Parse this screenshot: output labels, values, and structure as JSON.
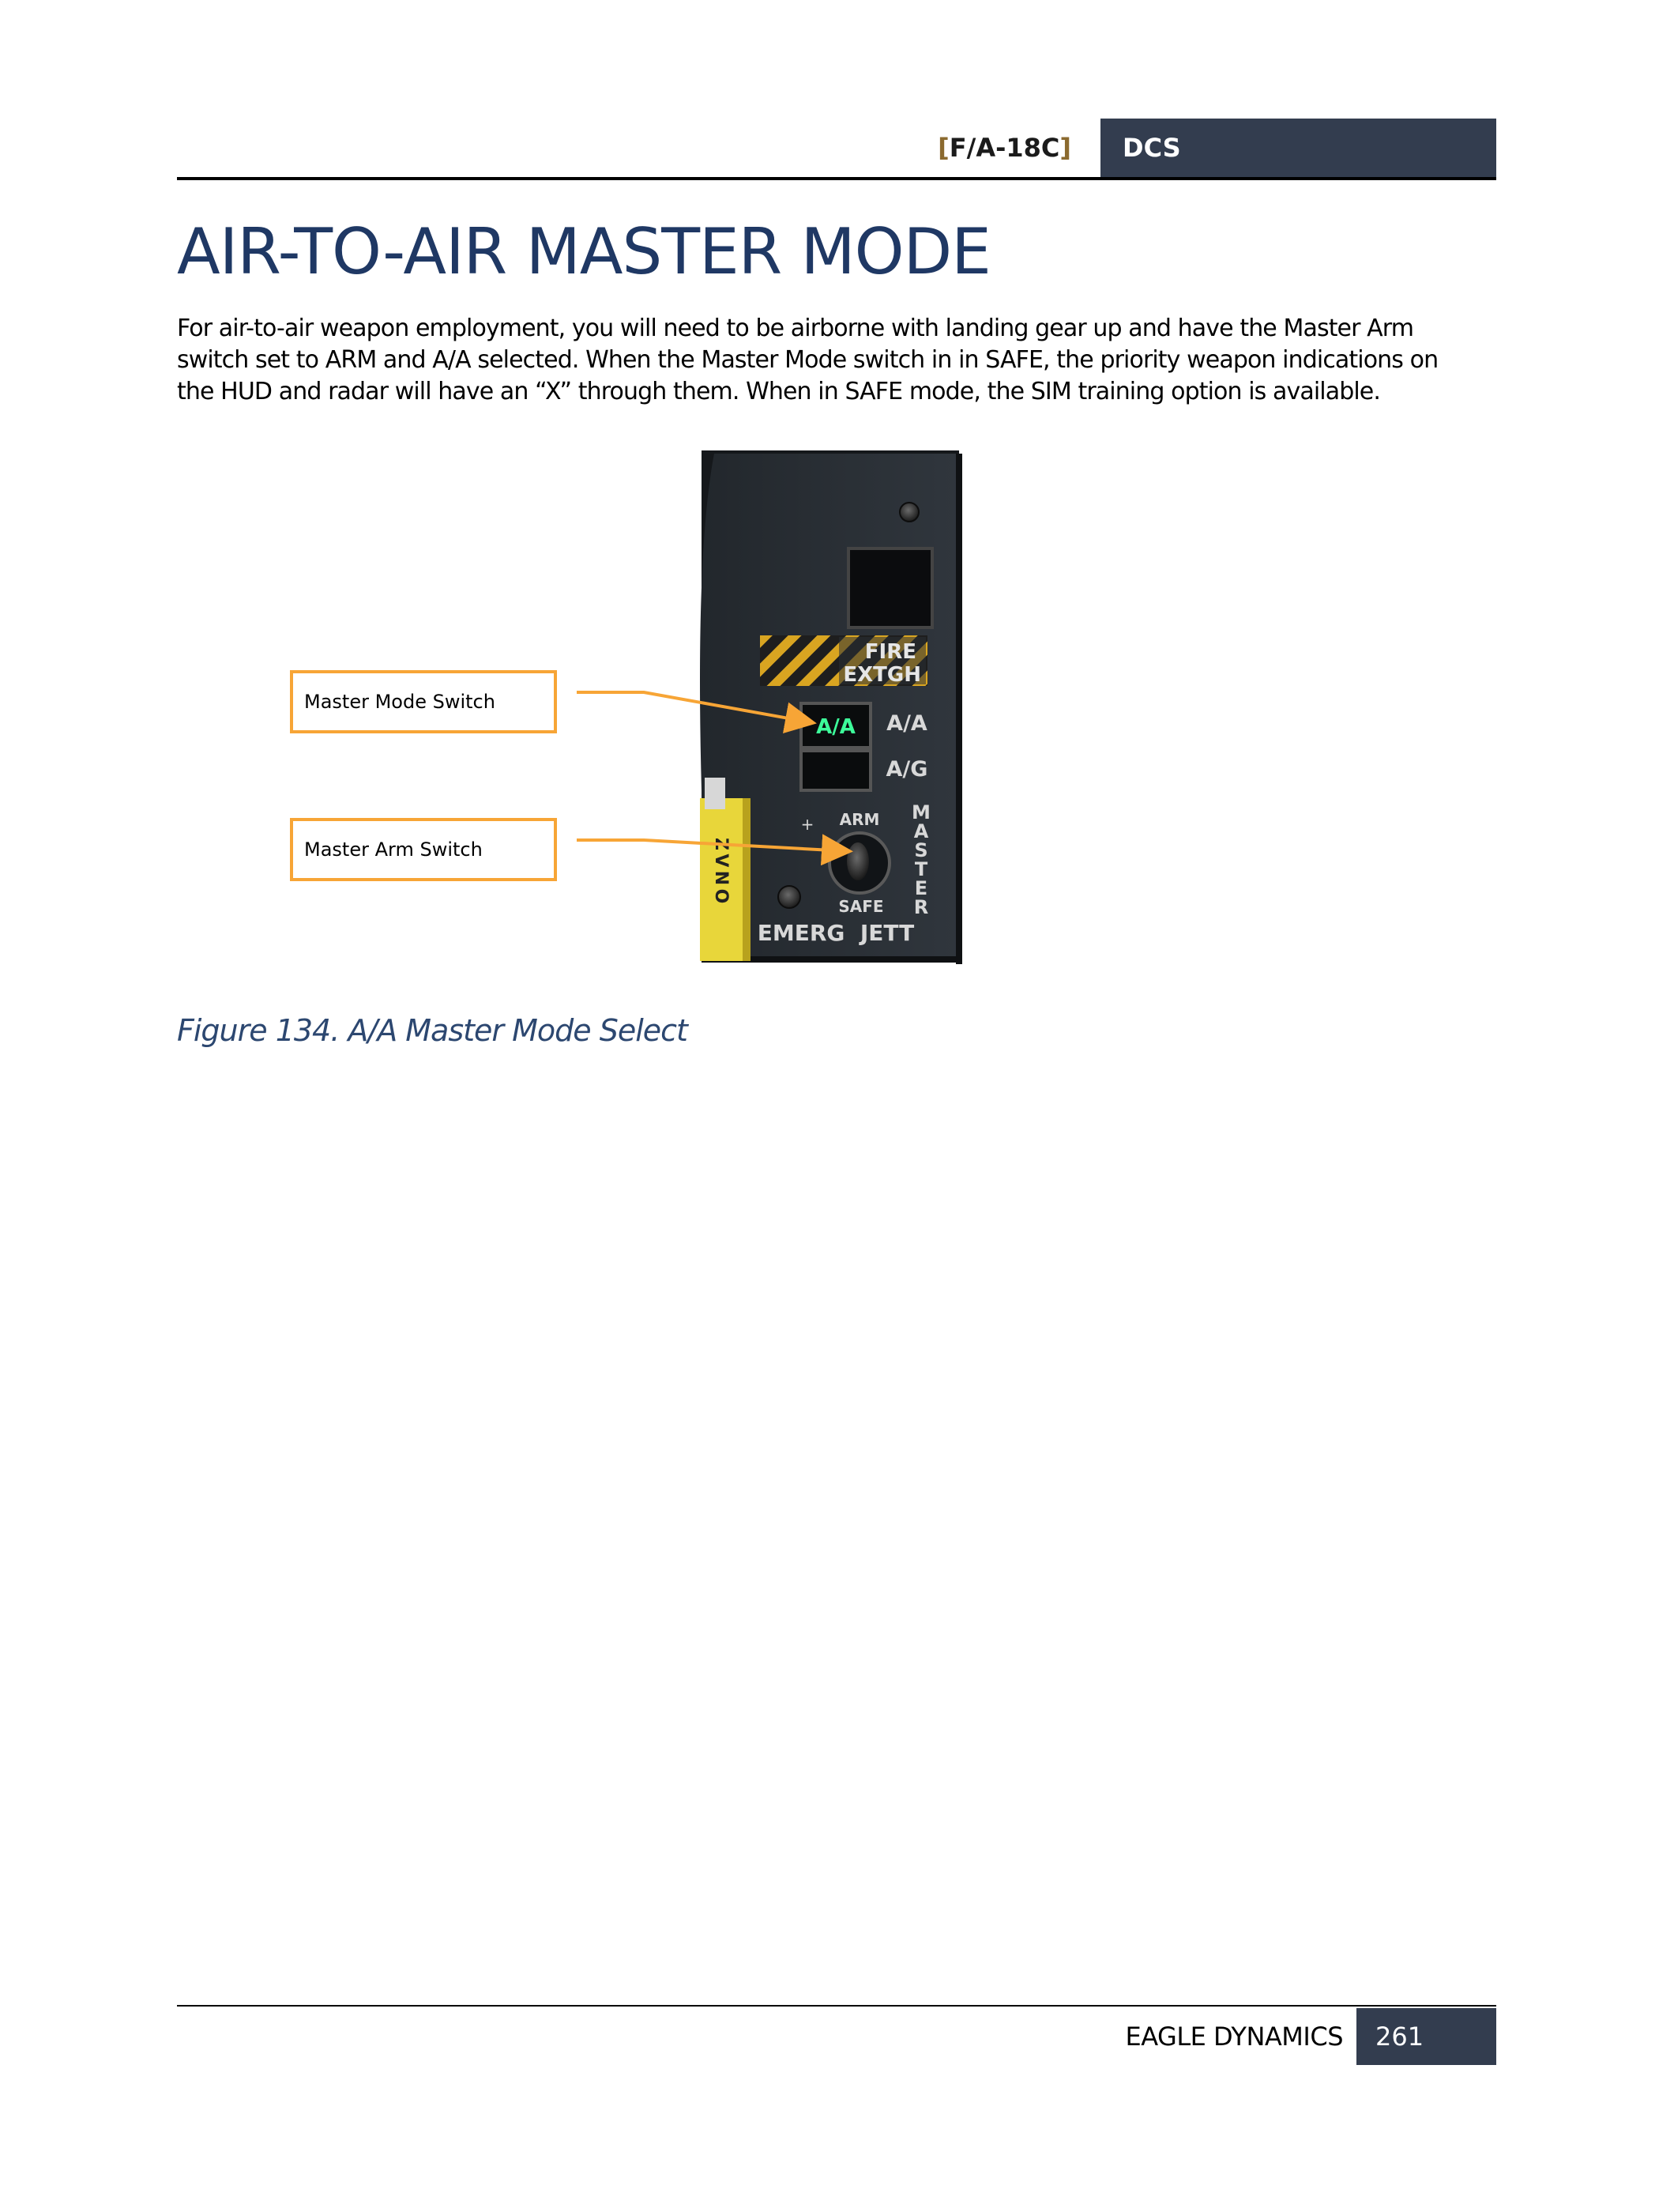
{
  "header": {
    "product_open": "[",
    "product": "F/A-18C",
    "product_close": "]",
    "brand": "DCS"
  },
  "page_title": "AIR-TO-AIR MASTER MODE",
  "body_lines": [
    "For air-to-air weapon employment, you will need to be airborne with landing gear up and have the Master Arm",
    "switch set to ARM and A/A selected. When the Master Mode switch in in SAFE, the priority weapon indications on",
    "the HUD and radar will have an “X” through them. When in SAFE mode, the SIM training option is available."
  ],
  "figure": {
    "callouts": {
      "master_mode": "Master Mode Switch",
      "master_arm": "Master Arm Switch"
    },
    "panel_labels": {
      "fire_line1": "FIRE",
      "fire_line2": "EXTGH",
      "aa_button": "A/A",
      "aa_label": "A/A",
      "ag_label": "A/G",
      "arm": "ARM",
      "safe": "SAFE",
      "master": [
        "M",
        "A",
        "S",
        "T",
        "E",
        "R"
      ],
      "emerg_jett": "EMERG  JETT",
      "side_placard": "Z V N O"
    },
    "colors": {
      "callout_border": "#f7a536",
      "arrow": "#f7a536",
      "aa_lit": "#3dff9a",
      "panel": "#2a2f35"
    },
    "caption": "Figure 134. A/A Master Mode Select"
  },
  "footer": {
    "company": "EAGLE DYNAMICS",
    "page_number": "261"
  }
}
